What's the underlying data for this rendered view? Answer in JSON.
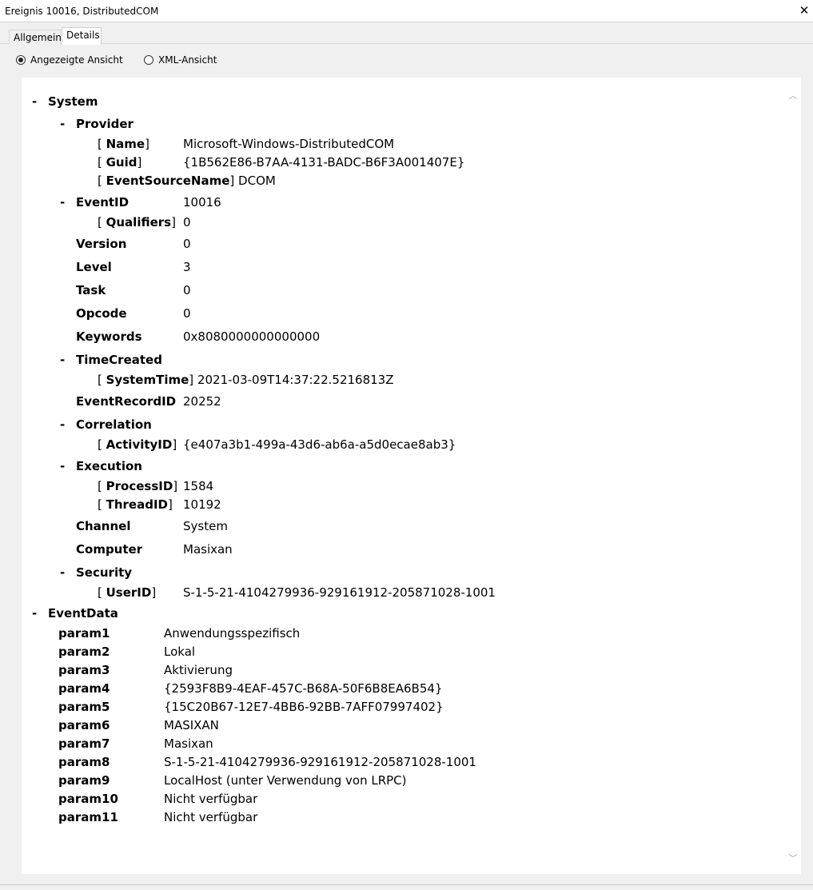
{
  "window": {
    "title": "Ereignis 10016, DistributedCOM",
    "close": "✕"
  },
  "tabs": [
    {
      "label": "Allgemein"
    },
    {
      "label": "Details"
    }
  ],
  "view": {
    "friendly": "Angezeigte Ansicht",
    "xml": "XML-Ansicht",
    "selected": "friendly"
  },
  "tree": {
    "toggle": "-",
    "lb": "[ ",
    "rb": "]",
    "system": {
      "label": "System",
      "provider": {
        "label": "Provider",
        "name_key": "Name",
        "name_val": "Microsoft-Windows-DistributedCOM",
        "guid_key": "Guid",
        "guid_val": "{1B562E86-B7AA-4131-BADC-B6F3A001407E}",
        "esn_key": "EventSourceName",
        "esn_val": "DCOM"
      },
      "eventid": {
        "label": "EventID",
        "value": "10016",
        "qual_key": "Qualifiers",
        "qual_val": "0"
      },
      "version": {
        "label": "Version",
        "value": "0"
      },
      "level": {
        "label": "Level",
        "value": "3"
      },
      "task": {
        "label": "Task",
        "value": "0"
      },
      "opcode": {
        "label": "Opcode",
        "value": "0"
      },
      "keywords": {
        "label": "Keywords",
        "value": "0x8080000000000000"
      },
      "timecreated": {
        "label": "TimeCreated",
        "st_key": "SystemTime",
        "st_val": "2021-03-09T14:37:22.5216813Z"
      },
      "eventrecordid": {
        "label": "EventRecordID",
        "value": "20252"
      },
      "correlation": {
        "label": "Correlation",
        "aid_key": "ActivityID",
        "aid_val": "{e407a3b1-499a-43d6-ab6a-a5d0ecae8ab3}"
      },
      "execution": {
        "label": "Execution",
        "pid_key": "ProcessID",
        "pid_val": "1584",
        "tid_key": "ThreadID",
        "tid_val": "10192"
      },
      "channel": {
        "label": "Channel",
        "value": "System"
      },
      "computer": {
        "label": "Computer",
        "value": "Masixan"
      },
      "security": {
        "label": "Security",
        "uid_key": "UserID",
        "uid_val": "S-1-5-21-4104279936-929161912-205871028-1001"
      }
    },
    "eventdata": {
      "label": "EventData",
      "params": [
        {
          "name": "param1",
          "value": "Anwendungsspezifisch"
        },
        {
          "name": "param2",
          "value": "Lokal"
        },
        {
          "name": "param3",
          "value": "Aktivierung"
        },
        {
          "name": "param4",
          "value": "{2593F8B9-4EAF-457C-B68A-50F6B8EA6B54}"
        },
        {
          "name": "param5",
          "value": "{15C20B67-12E7-4BB6-92BB-7AFF07997402}"
        },
        {
          "name": "param6",
          "value": "MASIXAN"
        },
        {
          "name": "param7",
          "value": "Masixan"
        },
        {
          "name": "param8",
          "value": "S-1-5-21-4104279936-929161912-205871028-1001"
        },
        {
          "name": "param9",
          "value": "LocalHost (unter Verwendung von LRPC)"
        },
        {
          "name": "param10",
          "value": "Nicht verfügbar"
        },
        {
          "name": "param11",
          "value": "Nicht verfügbar"
        }
      ]
    }
  }
}
